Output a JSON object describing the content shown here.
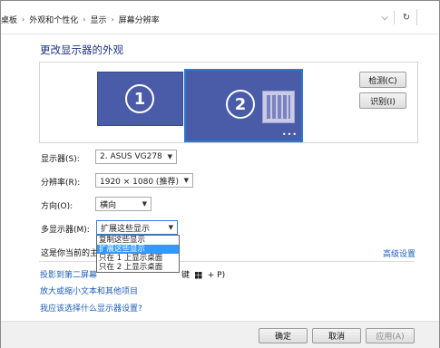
{
  "breadcrumb": {
    "items": [
      "桌板",
      "外观和个性化",
      "显示",
      "屏幕分辨率"
    ]
  },
  "address_bar": {
    "refresh_icon": "refresh-icon",
    "dropdown_icon": "chevron-down-icon"
  },
  "page": {
    "title": "更改显示器的外观"
  },
  "preview": {
    "monitor1_number": "1",
    "monitor2_number": "2",
    "monitor_color": "#4a5ba8",
    "selected_border_color": "#2a7ad0",
    "more_dots": "•••",
    "detect_button": "检测(C)",
    "identify_button": "识别(I)"
  },
  "settings": {
    "display_label": "显示器(S):",
    "display_value": "2. ASUS VG278",
    "resolution_label": "分辨率(R):",
    "resolution_value": "1920 × 1080 (推荐)",
    "orientation_label": "方向(O):",
    "orientation_value": "横向",
    "multi_label": "多显示器(M):",
    "multi_value": "扩展这些显示",
    "multi_options": [
      "复制这些显示",
      "扩展这些显示",
      "只在 1 上显示桌面",
      "只在 2 上显示桌面"
    ],
    "multi_highlighted_index": 1
  },
  "status": {
    "current_text_prefix": "这是你当前的主"
  },
  "links": {
    "advanced": "高级设置",
    "project_prefix": "投影到第二屏幕",
    "project_key_text": "键",
    "project_suffix": "+ P)",
    "text_size": "放大或缩小文本和其他项目",
    "which_settings": "我应该选择什么显示器设置?"
  },
  "footer": {
    "ok_button": "确定",
    "cancel_button": "取消",
    "apply_button": "应用(A)"
  }
}
